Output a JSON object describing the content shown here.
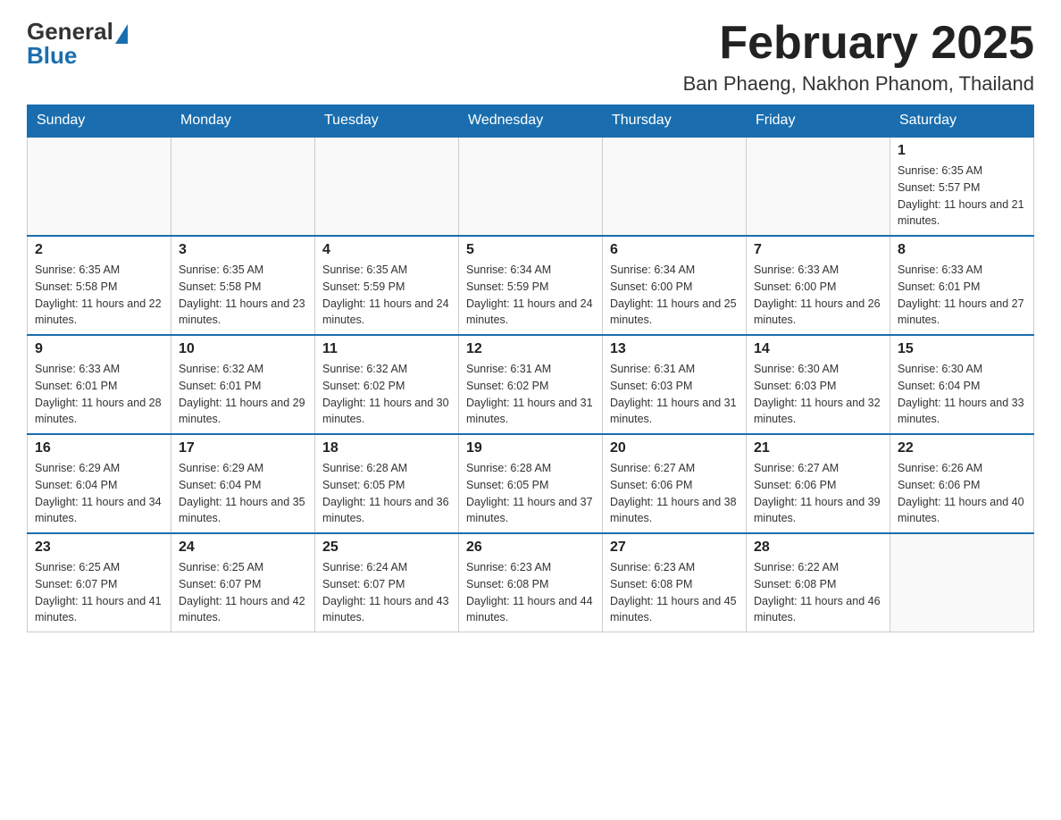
{
  "logo": {
    "general": "General",
    "blue": "Blue"
  },
  "title": "February 2025",
  "location": "Ban Phaeng, Nakhon Phanom, Thailand",
  "weekdays": [
    "Sunday",
    "Monday",
    "Tuesday",
    "Wednesday",
    "Thursday",
    "Friday",
    "Saturday"
  ],
  "weeks": [
    [
      {
        "day": "",
        "info": ""
      },
      {
        "day": "",
        "info": ""
      },
      {
        "day": "",
        "info": ""
      },
      {
        "day": "",
        "info": ""
      },
      {
        "day": "",
        "info": ""
      },
      {
        "day": "",
        "info": ""
      },
      {
        "day": "1",
        "info": "Sunrise: 6:35 AM\nSunset: 5:57 PM\nDaylight: 11 hours and 21 minutes."
      }
    ],
    [
      {
        "day": "2",
        "info": "Sunrise: 6:35 AM\nSunset: 5:58 PM\nDaylight: 11 hours and 22 minutes."
      },
      {
        "day": "3",
        "info": "Sunrise: 6:35 AM\nSunset: 5:58 PM\nDaylight: 11 hours and 23 minutes."
      },
      {
        "day": "4",
        "info": "Sunrise: 6:35 AM\nSunset: 5:59 PM\nDaylight: 11 hours and 24 minutes."
      },
      {
        "day": "5",
        "info": "Sunrise: 6:34 AM\nSunset: 5:59 PM\nDaylight: 11 hours and 24 minutes."
      },
      {
        "day": "6",
        "info": "Sunrise: 6:34 AM\nSunset: 6:00 PM\nDaylight: 11 hours and 25 minutes."
      },
      {
        "day": "7",
        "info": "Sunrise: 6:33 AM\nSunset: 6:00 PM\nDaylight: 11 hours and 26 minutes."
      },
      {
        "day": "8",
        "info": "Sunrise: 6:33 AM\nSunset: 6:01 PM\nDaylight: 11 hours and 27 minutes."
      }
    ],
    [
      {
        "day": "9",
        "info": "Sunrise: 6:33 AM\nSunset: 6:01 PM\nDaylight: 11 hours and 28 minutes."
      },
      {
        "day": "10",
        "info": "Sunrise: 6:32 AM\nSunset: 6:01 PM\nDaylight: 11 hours and 29 minutes."
      },
      {
        "day": "11",
        "info": "Sunrise: 6:32 AM\nSunset: 6:02 PM\nDaylight: 11 hours and 30 minutes."
      },
      {
        "day": "12",
        "info": "Sunrise: 6:31 AM\nSunset: 6:02 PM\nDaylight: 11 hours and 31 minutes."
      },
      {
        "day": "13",
        "info": "Sunrise: 6:31 AM\nSunset: 6:03 PM\nDaylight: 11 hours and 31 minutes."
      },
      {
        "day": "14",
        "info": "Sunrise: 6:30 AM\nSunset: 6:03 PM\nDaylight: 11 hours and 32 minutes."
      },
      {
        "day": "15",
        "info": "Sunrise: 6:30 AM\nSunset: 6:04 PM\nDaylight: 11 hours and 33 minutes."
      }
    ],
    [
      {
        "day": "16",
        "info": "Sunrise: 6:29 AM\nSunset: 6:04 PM\nDaylight: 11 hours and 34 minutes."
      },
      {
        "day": "17",
        "info": "Sunrise: 6:29 AM\nSunset: 6:04 PM\nDaylight: 11 hours and 35 minutes."
      },
      {
        "day": "18",
        "info": "Sunrise: 6:28 AM\nSunset: 6:05 PM\nDaylight: 11 hours and 36 minutes."
      },
      {
        "day": "19",
        "info": "Sunrise: 6:28 AM\nSunset: 6:05 PM\nDaylight: 11 hours and 37 minutes."
      },
      {
        "day": "20",
        "info": "Sunrise: 6:27 AM\nSunset: 6:06 PM\nDaylight: 11 hours and 38 minutes."
      },
      {
        "day": "21",
        "info": "Sunrise: 6:27 AM\nSunset: 6:06 PM\nDaylight: 11 hours and 39 minutes."
      },
      {
        "day": "22",
        "info": "Sunrise: 6:26 AM\nSunset: 6:06 PM\nDaylight: 11 hours and 40 minutes."
      }
    ],
    [
      {
        "day": "23",
        "info": "Sunrise: 6:25 AM\nSunset: 6:07 PM\nDaylight: 11 hours and 41 minutes."
      },
      {
        "day": "24",
        "info": "Sunrise: 6:25 AM\nSunset: 6:07 PM\nDaylight: 11 hours and 42 minutes."
      },
      {
        "day": "25",
        "info": "Sunrise: 6:24 AM\nSunset: 6:07 PM\nDaylight: 11 hours and 43 minutes."
      },
      {
        "day": "26",
        "info": "Sunrise: 6:23 AM\nSunset: 6:08 PM\nDaylight: 11 hours and 44 minutes."
      },
      {
        "day": "27",
        "info": "Sunrise: 6:23 AM\nSunset: 6:08 PM\nDaylight: 11 hours and 45 minutes."
      },
      {
        "day": "28",
        "info": "Sunrise: 6:22 AM\nSunset: 6:08 PM\nDaylight: 11 hours and 46 minutes."
      },
      {
        "day": "",
        "info": ""
      }
    ]
  ]
}
